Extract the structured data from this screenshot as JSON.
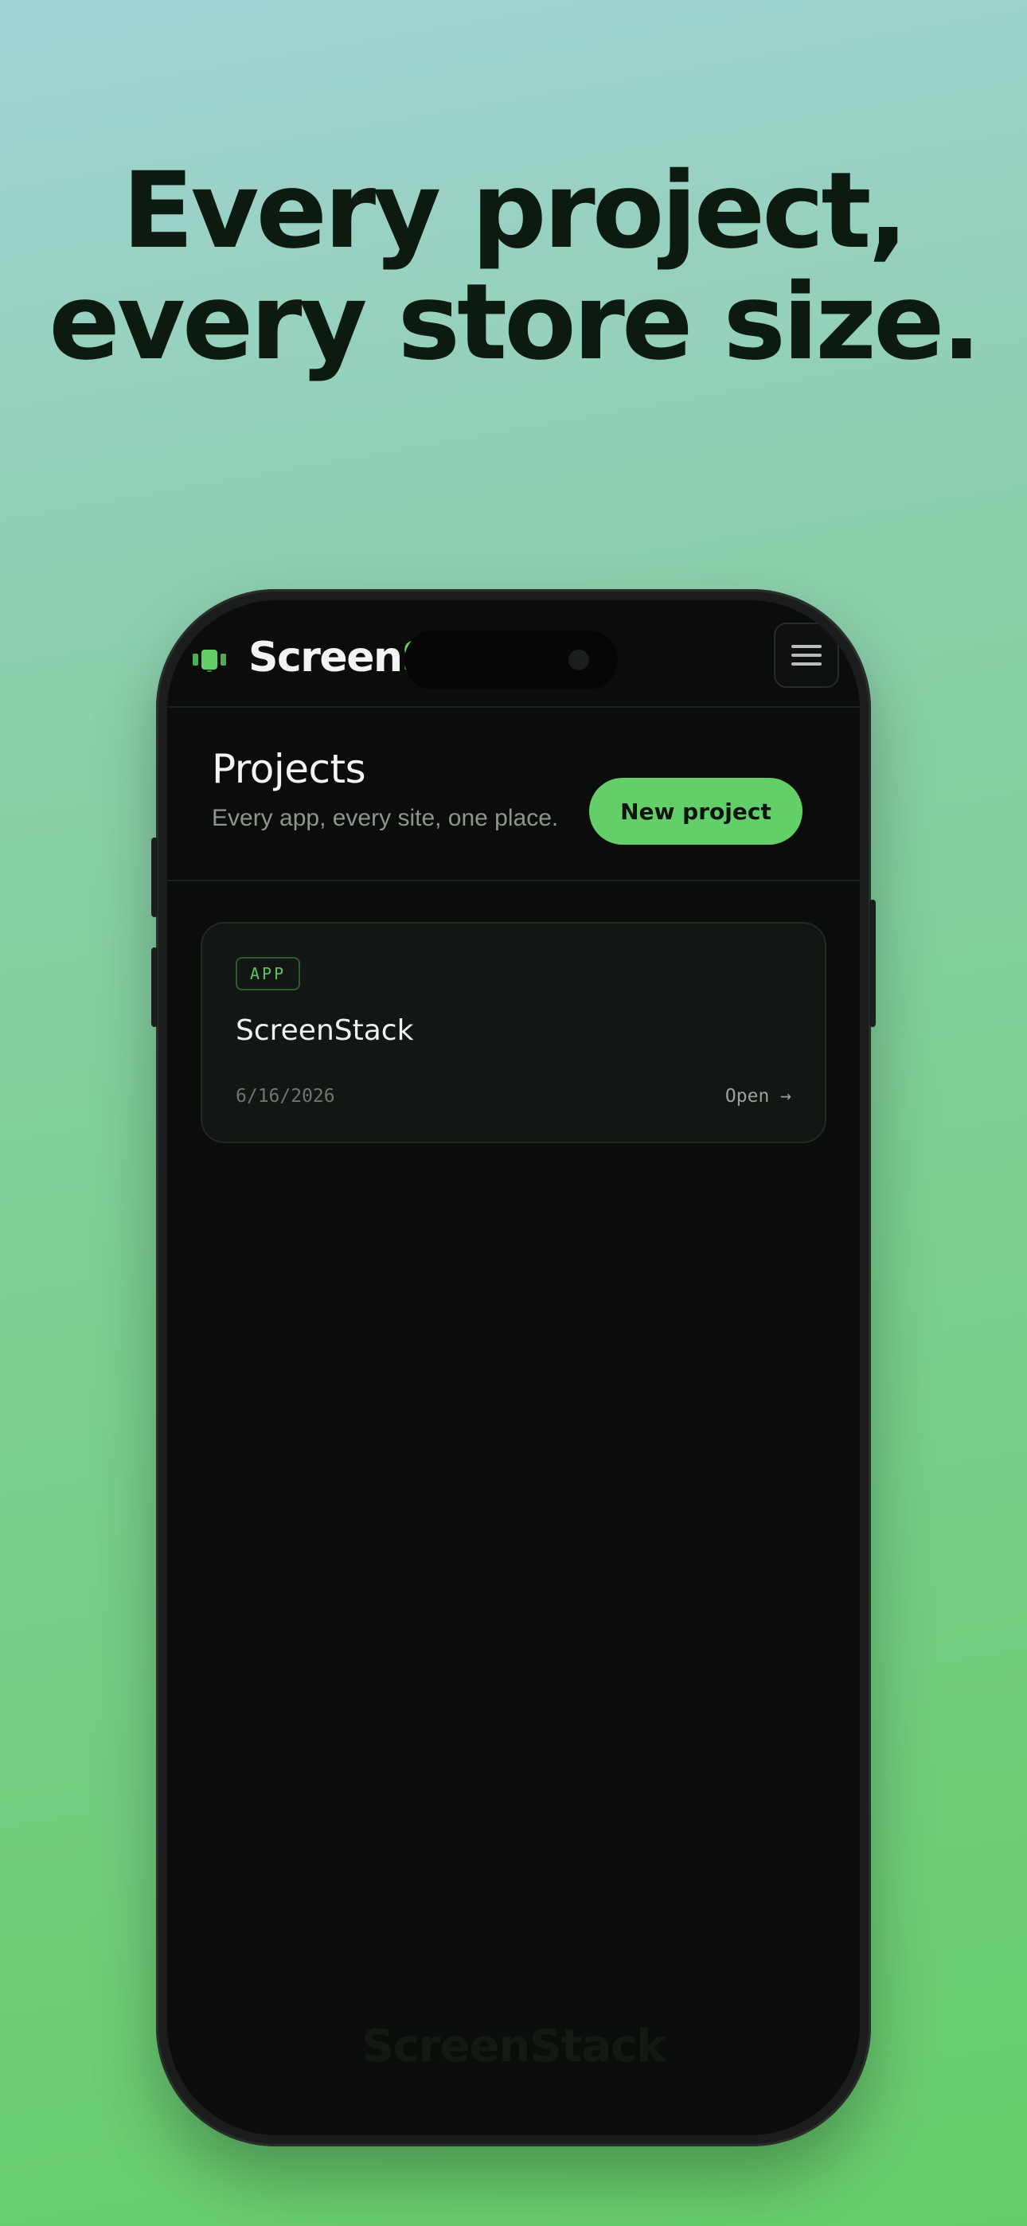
{
  "headline": {
    "line1": "Every project,",
    "line2": "every store size."
  },
  "app": {
    "logo": {
      "prefix": "Screen",
      "accent_part": "S’",
      "icon": "screenstack-logo-icon"
    },
    "menu_button": {
      "icon": "hamburger-menu-icon"
    }
  },
  "projects": {
    "title": "Projects",
    "subtitle": "Every app, every site, one place.",
    "new_button_label": "New project",
    "items": [
      {
        "tag": "APP",
        "name": "ScreenStack",
        "date": "6/16/2026",
        "open_label": "Open →"
      }
    ]
  },
  "watermark": "ScreenStack",
  "colors": {
    "accent": "#63cf69",
    "screen_bg": "#0b0d0b",
    "card_bg": "#131714",
    "headline": "#0c1a0f"
  }
}
